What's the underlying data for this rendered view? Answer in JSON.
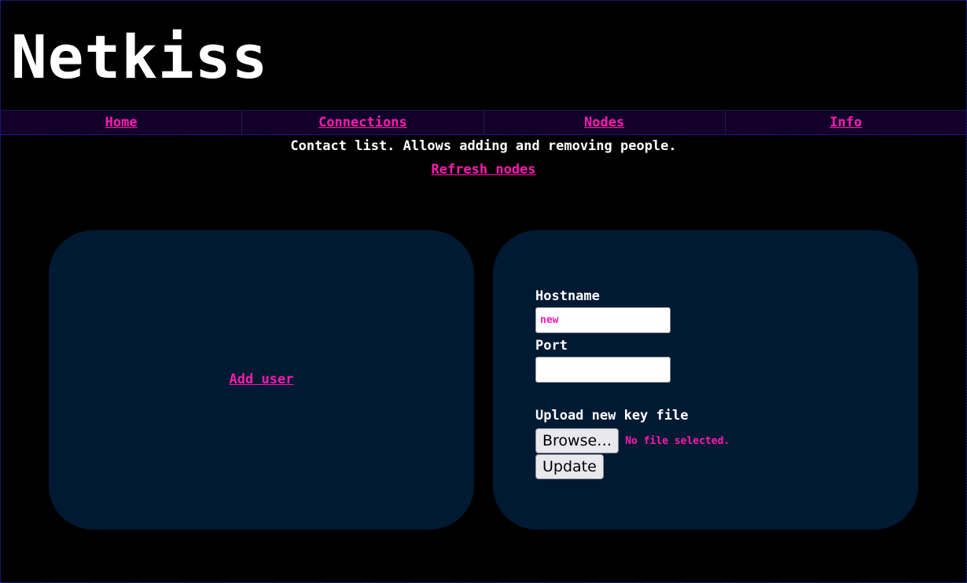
{
  "app": {
    "title": "Netkiss"
  },
  "nav": {
    "items": [
      {
        "label": "Home"
      },
      {
        "label": "Connections"
      },
      {
        "label": "Nodes"
      },
      {
        "label": "Info"
      }
    ]
  },
  "main": {
    "description": "Contact list. Allows adding and removing people.",
    "refresh_label": "Refresh nodes"
  },
  "left_card": {
    "add_user_label": "Add user"
  },
  "right_card": {
    "hostname_label": "Hostname",
    "hostname_value": "new",
    "port_label": "Port",
    "port_value": "",
    "upload_label": "Upload new key file",
    "browse_label": "Browse…",
    "file_status": "No file selected.",
    "update_label": "Update"
  },
  "colors": {
    "background": "#000000",
    "nav_background": "#12002a",
    "card_background": "#001a33",
    "accent_link": "#ff1ab0",
    "border": "#2b2bd6"
  }
}
